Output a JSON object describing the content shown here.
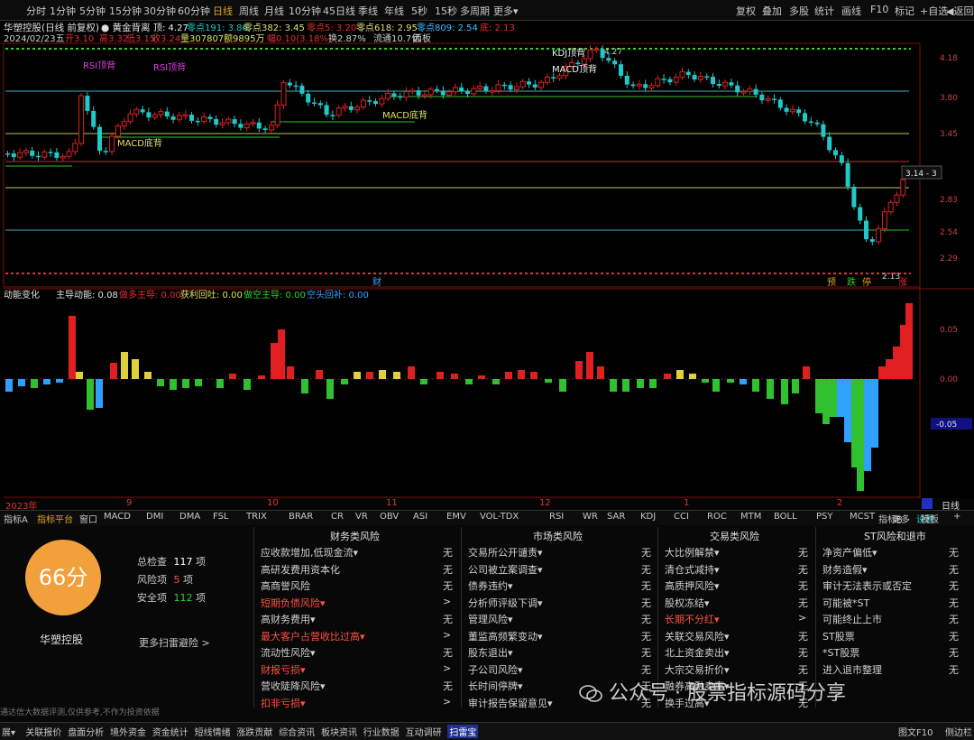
{
  "toolbar": {
    "items": [
      "分时",
      "1分钟",
      "5分钟",
      "15分钟",
      "30分钟",
      "60分钟",
      "日线",
      "周线",
      "月线",
      "10分钟",
      "45日线",
      "季线",
      "年线",
      "5秒",
      "15秒",
      "多周期",
      "更多"
    ],
    "more_suffix": "▾",
    "active": "日线",
    "right_items": [
      "复权",
      "叠加",
      "多股",
      "统计",
      "画线",
      "F10",
      "标记",
      "+自选",
      "◀返回"
    ]
  },
  "chart_header": {
    "stock": "华塑控股(日线 前复权)",
    "indicator": "● 黄金背离",
    "top": "顶: 4.27",
    "zero191": "零点191: 3.86",
    "zero382": "零点382: 3.45",
    "zero5": "零点5: 3.20",
    "zero618": "零点618: 2.95",
    "zero809": "零点809: 2.54",
    "bottom": "底: 2.13",
    "line2_date": "2024/02/23五",
    "line2_open": "开3.10",
    "line2_high": "高3.32",
    "line2_low": "低3.15",
    "line2_close": "收3.24",
    "line2_vol": "量307807",
    "line2_amt": "额9895万",
    "line2_chg": "幅0.10(3.18%)",
    "line2_turn": "换2.87%",
    "line2_float": "流通10.7亿",
    "line2_view": "面板"
  },
  "price_axis": [
    "4.18",
    "3.80",
    "3.45",
    "3.14",
    "2.83",
    "2.54",
    "2.29"
  ],
  "price_marker": "3.14 - 3",
  "annotations": {
    "rsi1": "RSI顶背",
    "rsi2": "RSI顶背",
    "kdj": "KDJ顶背",
    "macd_top": "MACD顶背",
    "macd_bottom1": "MACD底背",
    "macd_bottom2": "MACD底背",
    "peak_label": "4.27",
    "low_label": "2.13",
    "cai": "财",
    "bottom_right": [
      "预",
      "跌",
      "停",
      "涨"
    ]
  },
  "sub_header": {
    "name": "动能变化",
    "main": "主导动能: 0.08",
    "bear": "做多主导: 0.00",
    "profit": "获利回吐: 0.00",
    "empty": "做空主导: 0.00",
    "short": "空头回补: 0.00"
  },
  "sub_axis": [
    "0.05",
    "0.00",
    "0.05",
    "-0.05"
  ],
  "sub_marker": "-0.05",
  "time_axis": {
    "year": "2023年",
    "months": [
      "9",
      "10",
      "11",
      "12",
      "1",
      "2"
    ],
    "period": "日线"
  },
  "indicator_tabs": [
    "指标A",
    "指标平台",
    "窗口",
    "MACD",
    "DMI",
    "DMA",
    "FSL",
    "TRIX",
    "BRAR",
    "CR",
    "VR",
    "OBV",
    "ASI",
    "EMV",
    "VOL-TDX",
    "RSI",
    "WR",
    "SAR",
    "KDJ",
    "CCI",
    "ROC",
    "MTM",
    "BOLL",
    "PSY",
    "MCST",
    "更多",
    "设置"
  ],
  "indicator_tabs_right": [
    "指标B",
    "模板",
    "+"
  ],
  "risk": {
    "score": "66分",
    "total_label": "总检查",
    "total_value": "117",
    "risk_label": "风险项",
    "risk_value": "5",
    "safe_label": "安全项",
    "safe_value": "112",
    "unit": "项",
    "stock_name": "华塑控股",
    "more": "更多扫雷避险 >",
    "disclaimer": "通达信大数据评测,仅供参考,不作为投资依据",
    "columns": [
      {
        "title": "财务类风险",
        "rows": [
          {
            "name": "应收款增加,低现金流▾",
            "result": "无",
            "alert": false
          },
          {
            "name": "高研发费用资本化",
            "result": "无",
            "alert": false
          },
          {
            "name": "高商誉风险",
            "result": "无",
            "alert": false
          },
          {
            "name": "短期负债风险▾",
            "result": ">",
            "alert": true
          },
          {
            "name": "高财务费用▾",
            "result": "无",
            "alert": false
          },
          {
            "name": "最大客户占营收比过高▾",
            "result": ">",
            "alert": true
          },
          {
            "name": "流动性风险▾",
            "result": "无",
            "alert": false
          },
          {
            "name": "财报亏损▾",
            "result": ">",
            "alert": true
          },
          {
            "name": "营收陡降风险▾",
            "result": "无",
            "alert": false
          },
          {
            "name": "扣非亏损▾",
            "result": ">",
            "alert": true
          }
        ]
      },
      {
        "title": "市场类风险",
        "rows": [
          {
            "name": "交易所公开谴责▾",
            "result": "无",
            "alert": false
          },
          {
            "name": "公司被立案调查▾",
            "result": "无",
            "alert": false
          },
          {
            "name": "债券违约▾",
            "result": "无",
            "alert": false
          },
          {
            "name": "分析师评级下调▾",
            "result": "无",
            "alert": false
          },
          {
            "name": "管理风险▾",
            "result": "无",
            "alert": false
          },
          {
            "name": "董监高频繁变动▾",
            "result": "无",
            "alert": false
          },
          {
            "name": "股东退出▾",
            "result": "无",
            "alert": false
          },
          {
            "name": "子公司风险▾",
            "result": "无",
            "alert": false
          },
          {
            "name": "长时间停牌▾",
            "result": "无",
            "alert": false
          },
          {
            "name": "审计报告保留意见▾",
            "result": "无",
            "alert": false
          }
        ]
      },
      {
        "title": "交易类风险",
        "rows": [
          {
            "name": "大比例解禁▾",
            "result": "无",
            "alert": false
          },
          {
            "name": "清仓式减持▾",
            "result": "无",
            "alert": false
          },
          {
            "name": "高质押风险▾",
            "result": "无",
            "alert": false
          },
          {
            "name": "股权冻结▾",
            "result": "无",
            "alert": false
          },
          {
            "name": "长期不分红▾",
            "result": ">",
            "alert": true
          },
          {
            "name": "关联交易风险▾",
            "result": "无",
            "alert": false
          },
          {
            "name": "北上资金卖出▾",
            "result": "无",
            "alert": false
          },
          {
            "name": "大宗交易折价▾",
            "result": "无",
            "alert": false
          },
          {
            "name": "融券高融卖率▾",
            "result": "无",
            "alert": false
          },
          {
            "name": "换手过高▾",
            "result": "无",
            "alert": false
          }
        ]
      },
      {
        "title": "ST风险和退市",
        "rows": [
          {
            "name": "净资产偏低▾",
            "result": "无",
            "alert": false
          },
          {
            "name": "财务造假▾",
            "result": "无",
            "alert": false
          },
          {
            "name": "审计无法表示或否定",
            "result": "无",
            "alert": false
          },
          {
            "name": "可能被*ST",
            "result": "无",
            "alert": false
          },
          {
            "name": "可能终止上市",
            "result": "无",
            "alert": false
          },
          {
            "name": "ST股票",
            "result": "无",
            "alert": false
          },
          {
            "name": "*ST股票",
            "result": "无",
            "alert": false
          },
          {
            "name": "进入退市整理",
            "result": "无",
            "alert": false
          }
        ]
      }
    ]
  },
  "watermark": "公众号 · 股票指标源码分享",
  "bottom_tabs": [
    "展▾",
    "关联报价",
    "盘面分析",
    "境外资金",
    "资金统计",
    "短线情绪",
    "涨跌贡献",
    "综合资讯",
    "板块资讯",
    "行业数据",
    "互动调研",
    "扫雷宝"
  ],
  "bottom_right": [
    "图文F10",
    "侧边栏",
    "»"
  ],
  "colors": {
    "up": "#e02020",
    "down": "#20c8c8",
    "accent": "#e0a020",
    "alert": "#ff5040",
    "score_bg": "#f2a03c"
  }
}
